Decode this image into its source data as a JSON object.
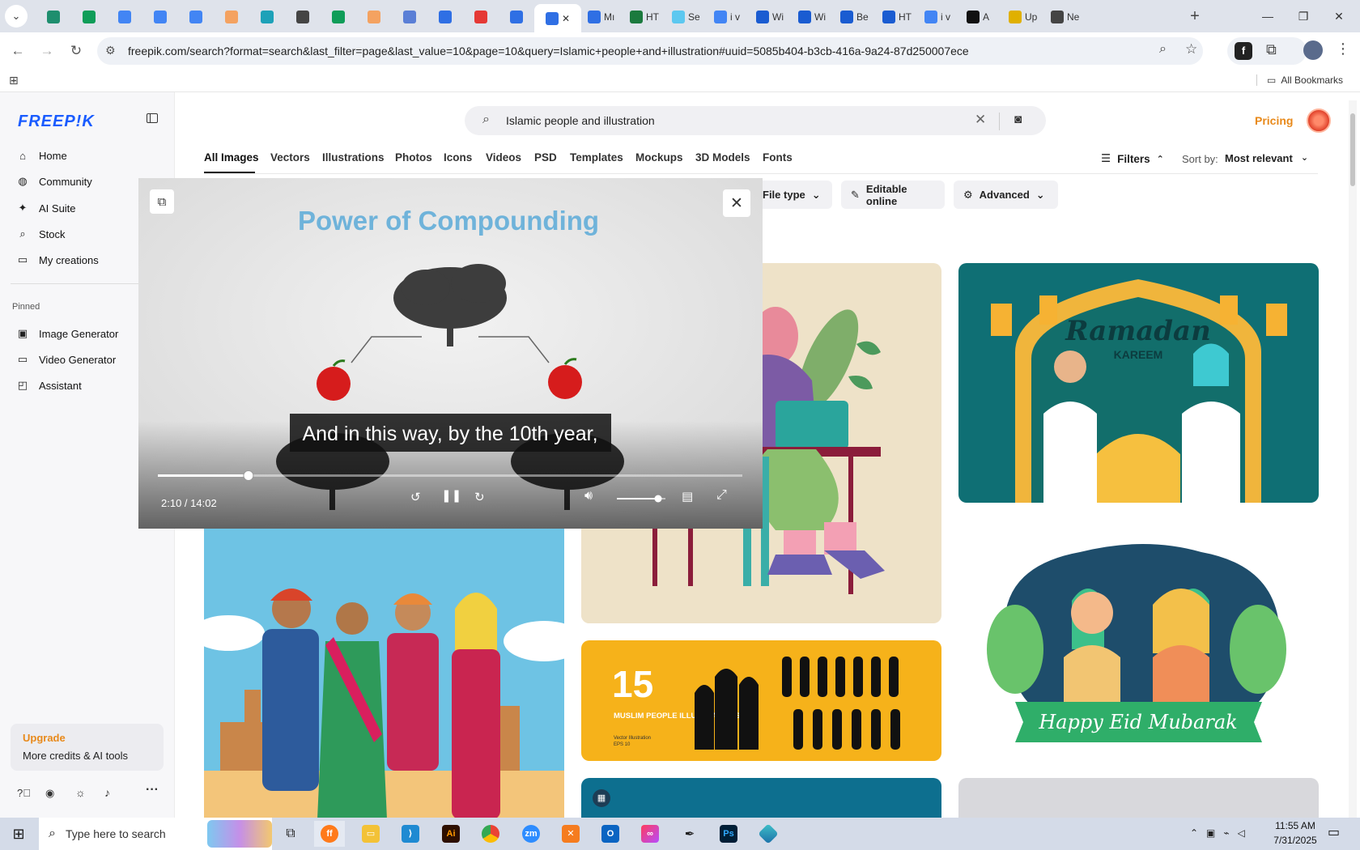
{
  "browser": {
    "tabs": [
      {
        "label": "",
        "color": "#1e8e6e"
      },
      {
        "label": "",
        "color": "#0f9d58"
      },
      {
        "label": "",
        "color": "#4285f4"
      },
      {
        "label": "",
        "color": "#4285f4"
      },
      {
        "label": "",
        "color": "#4285f4"
      },
      {
        "label": "",
        "color": "#f4a261"
      },
      {
        "label": "",
        "color": "#1da1b8"
      },
      {
        "label": "",
        "color": "#444"
      },
      {
        "label": "",
        "color": "#0f9d58"
      },
      {
        "label": "",
        "color": "#f4a261"
      },
      {
        "label": "",
        "color": "#5a7fd6"
      },
      {
        "label": "",
        "color": "#2f6fe4"
      },
      {
        "label": "",
        "color": "#e53935"
      },
      {
        "label": "",
        "color": "#2f6fe4"
      },
      {
        "label": "",
        "color": "#2f6fe4",
        "active": true
      },
      {
        "label": "Mı",
        "color": "#2f6fe4"
      },
      {
        "label": "HT",
        "color": "#1b7a3e"
      },
      {
        "label": "Se",
        "color": "#5cc8f0"
      },
      {
        "label": "i v",
        "color": "#4285f4"
      },
      {
        "label": "Wi",
        "color": "#1a5cd1"
      },
      {
        "label": "Wi",
        "color": "#1a5cd1"
      },
      {
        "label": "Be",
        "color": "#1a5cd1"
      },
      {
        "label": "HT",
        "color": "#1a5cd1"
      },
      {
        "label": "i v",
        "color": "#4285f4"
      },
      {
        "label": "A",
        "color": "#111"
      },
      {
        "label": "Up",
        "color": "#e0b000"
      },
      {
        "label": "Ne",
        "color": "#444"
      }
    ],
    "url": "freepik.com/search?format=search&last_filter=page&last_value=10&page=10&query=Islamic+people+and+illustration#uuid=5085b404-b3cb-416a-9a24-87d250007ece",
    "bookmarks_label": "All Bookmarks"
  },
  "sidebar": {
    "logo": "FREEP!K",
    "nav": [
      {
        "label": "Home",
        "icon": "home-icon"
      },
      {
        "label": "Community",
        "icon": "globe-icon"
      },
      {
        "label": "AI Suite",
        "icon": "sparkle-icon"
      },
      {
        "label": "Stock",
        "icon": "search-icon"
      },
      {
        "label": "My creations",
        "icon": "folder-icon"
      }
    ],
    "pinned_heading": "Pinned",
    "pinned": [
      {
        "label": "Image Generator",
        "icon": "image-icon"
      },
      {
        "label": "Video Generator",
        "icon": "video-icon"
      },
      {
        "label": "Assistant",
        "icon": "assistant-icon"
      }
    ],
    "upgrade_title": "Upgrade",
    "upgrade_sub": "More credits & AI tools"
  },
  "header": {
    "search_value": "Islamic people and illustration",
    "pricing": "Pricing"
  },
  "categories": [
    "All Images",
    "Vectors",
    "Illustrations",
    "Photos",
    "Icons",
    "Videos",
    "PSD",
    "Templates",
    "Mockups",
    "3D Models",
    "Fonts"
  ],
  "filters": {
    "label": "Filters",
    "sort_label": "Sort by:",
    "sort_value": "Most relevant"
  },
  "chips": [
    "File type",
    "Editable online",
    "Advanced"
  ],
  "video": {
    "title": "Power of Compounding",
    "caption": "And in this way, by the 10th year,",
    "time": "2:10 / 14:02",
    "progress": 0.155,
    "volume": 0.85
  },
  "cards": {
    "ramadan_title": "Ramadan",
    "ramadan_sub": "KAREEM",
    "eid_text": "Happy Eid Mubarak",
    "muslim_count": "15",
    "muslim_text": "MUSLIM PEOPLE ILLUSTRATIONS",
    "muslim_sub": "Vector Illustration",
    "muslim_eps": "EPS 10"
  },
  "taskbar": {
    "search_placeholder": "Type here to search",
    "time": "11:55 AM",
    "date": "7/31/2025"
  }
}
